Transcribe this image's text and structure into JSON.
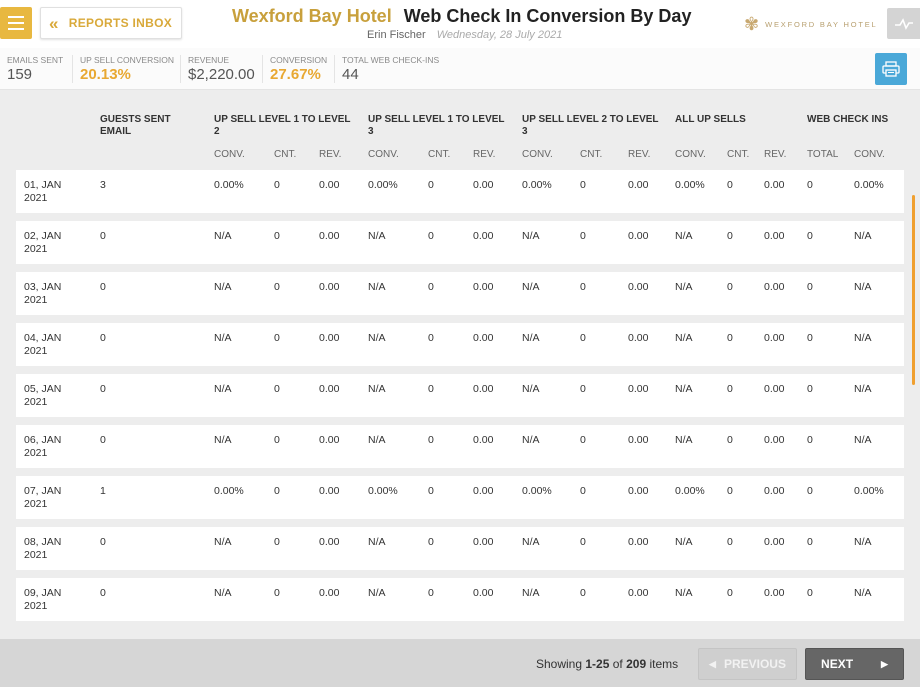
{
  "header": {
    "inbox_label": "REPORTS INBOX",
    "hotel_name": "Wexford Bay Hotel",
    "report_name": "Web Check In Conversion By Day",
    "user_name": "Erin Fischer",
    "date": "Wednesday, 28 July 2021",
    "logo_text": "WEXFORD BAY HOTEL"
  },
  "stats": [
    {
      "label": "EMAILS SENT",
      "value": "159"
    },
    {
      "label": "UP SELL CONVERSION",
      "value": "20.13%"
    },
    {
      "label": "REVENUE",
      "value": "$2,220.00"
    },
    {
      "label": "CONVERSION",
      "value": "27.67%"
    },
    {
      "label": "TOTAL WEB CHECK-INS",
      "value": "44"
    }
  ],
  "table": {
    "groups": [
      {
        "label": "GUESTS SENT EMAIL"
      },
      {
        "label": "UP SELL LEVEL 1 TO LEVEL 2"
      },
      {
        "label": "UP SELL LEVEL 1 TO LEVEL 3"
      },
      {
        "label": "UP SELL LEVEL 2 TO LEVEL 3"
      },
      {
        "label": "ALL UP SELLS"
      },
      {
        "label": "WEB CHECK INS"
      }
    ],
    "subheaders": [
      "CONV.",
      "CNT.",
      "REV.",
      "CONV.",
      "CNT.",
      "REV.",
      "CONV.",
      "CNT.",
      "REV.",
      "CONV.",
      "CNT.",
      "REV.",
      "TOTAL",
      "CONV."
    ],
    "rows": [
      {
        "date": "01, JAN\n2021",
        "cells": [
          "3",
          "0.00%",
          "0",
          "0.00",
          "0.00%",
          "0",
          "0.00",
          "0.00%",
          "0",
          "0.00",
          "0.00%",
          "0",
          "0.00",
          "0",
          "0.00%"
        ]
      },
      {
        "date": "02, JAN\n2021",
        "cells": [
          "0",
          "N/A",
          "0",
          "0.00",
          "N/A",
          "0",
          "0.00",
          "N/A",
          "0",
          "0.00",
          "N/A",
          "0",
          "0.00",
          "0",
          "N/A"
        ]
      },
      {
        "date": "03, JAN\n2021",
        "cells": [
          "0",
          "N/A",
          "0",
          "0.00",
          "N/A",
          "0",
          "0.00",
          "N/A",
          "0",
          "0.00",
          "N/A",
          "0",
          "0.00",
          "0",
          "N/A"
        ]
      },
      {
        "date": "04, JAN\n2021",
        "cells": [
          "0",
          "N/A",
          "0",
          "0.00",
          "N/A",
          "0",
          "0.00",
          "N/A",
          "0",
          "0.00",
          "N/A",
          "0",
          "0.00",
          "0",
          "N/A"
        ]
      },
      {
        "date": "05, JAN\n2021",
        "cells": [
          "0",
          "N/A",
          "0",
          "0.00",
          "N/A",
          "0",
          "0.00",
          "N/A",
          "0",
          "0.00",
          "N/A",
          "0",
          "0.00",
          "0",
          "N/A"
        ]
      },
      {
        "date": "06, JAN\n2021",
        "cells": [
          "0",
          "N/A",
          "0",
          "0.00",
          "N/A",
          "0",
          "0.00",
          "N/A",
          "0",
          "0.00",
          "N/A",
          "0",
          "0.00",
          "0",
          "N/A"
        ]
      },
      {
        "date": "07, JAN\n2021",
        "cells": [
          "1",
          "0.00%",
          "0",
          "0.00",
          "0.00%",
          "0",
          "0.00",
          "0.00%",
          "0",
          "0.00",
          "0.00%",
          "0",
          "0.00",
          "0",
          "0.00%"
        ]
      },
      {
        "date": "08, JAN\n2021",
        "cells": [
          "0",
          "N/A",
          "0",
          "0.00",
          "N/A",
          "0",
          "0.00",
          "N/A",
          "0",
          "0.00",
          "N/A",
          "0",
          "0.00",
          "0",
          "N/A"
        ]
      },
      {
        "date": "09, JAN\n2021",
        "cells": [
          "0",
          "N/A",
          "0",
          "0.00",
          "N/A",
          "0",
          "0.00",
          "N/A",
          "0",
          "0.00",
          "N/A",
          "0",
          "0.00",
          "0",
          "N/A"
        ]
      }
    ]
  },
  "pagination": {
    "showing_prefix": "Showing",
    "range": "1-25",
    "of_word": "of",
    "total": "209",
    "items_word": "items",
    "previous_label": "PREVIOUS",
    "next_label": "NEXT"
  },
  "colors": {
    "accent_gold": "#e8b840",
    "print_blue": "#4aa8d8"
  }
}
